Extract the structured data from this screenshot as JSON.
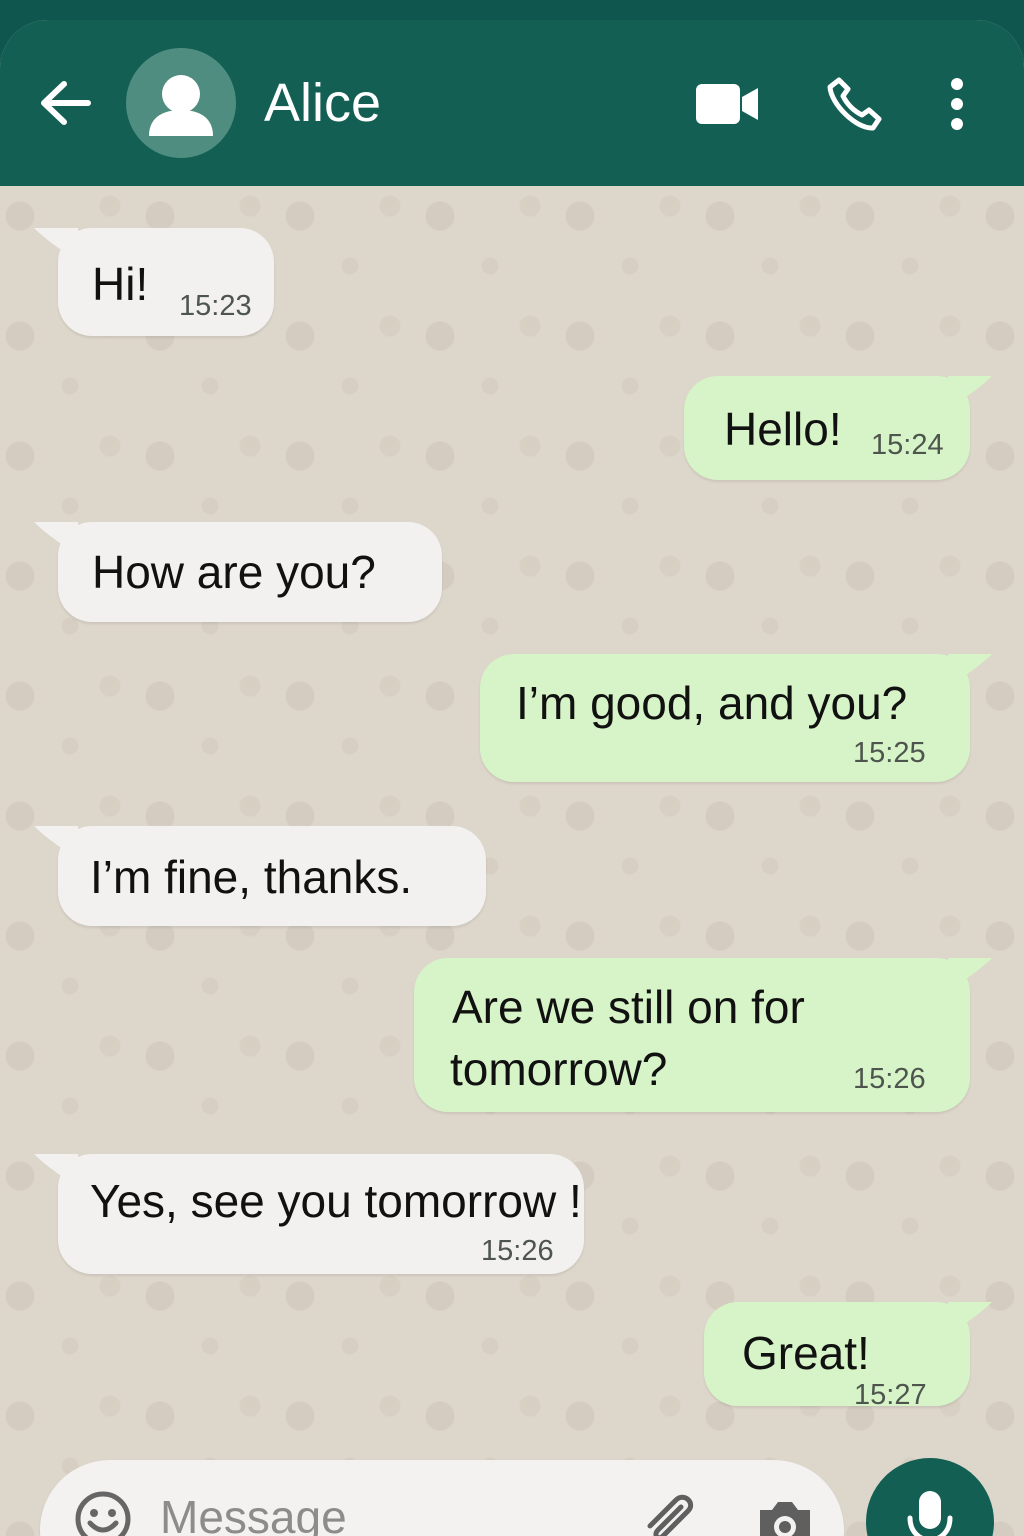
{
  "header": {
    "contact_name": "Alice",
    "icons": [
      "back-arrow-icon",
      "avatar-person-icon",
      "video-camera-icon",
      "phone-icon",
      "more-vertical-icon"
    ]
  },
  "messages": [
    {
      "direction": "incoming",
      "text": "Hi!",
      "time": "15:23"
    },
    {
      "direction": "outgoing",
      "text": "Hello!",
      "time": "15:24"
    },
    {
      "direction": "incoming",
      "text": "How are you?",
      "time": ""
    },
    {
      "direction": "outgoing",
      "text": "I’m good, and you?",
      "time": "15:25"
    },
    {
      "direction": "incoming",
      "text": "I’m fine, thanks.",
      "time": ""
    },
    {
      "direction": "outgoing",
      "text_line1": "Are we still on for",
      "text_line2": "tomorrow?",
      "time": "15:26"
    },
    {
      "direction": "incoming",
      "text": "Yes, see you tomorrow !",
      "time": "15:26"
    },
    {
      "direction": "outgoing",
      "text": "Great!",
      "time": "15:27"
    }
  ],
  "composer": {
    "placeholder": "Message",
    "icons": [
      "emoji-icon",
      "paperclip-icon",
      "camera-icon",
      "microphone-icon"
    ]
  },
  "colors": {
    "header": "#135f54",
    "background": "#ddd6ca",
    "incoming_bubble": "#f2f1ef",
    "outgoing_bubble": "#d6f4c7"
  }
}
